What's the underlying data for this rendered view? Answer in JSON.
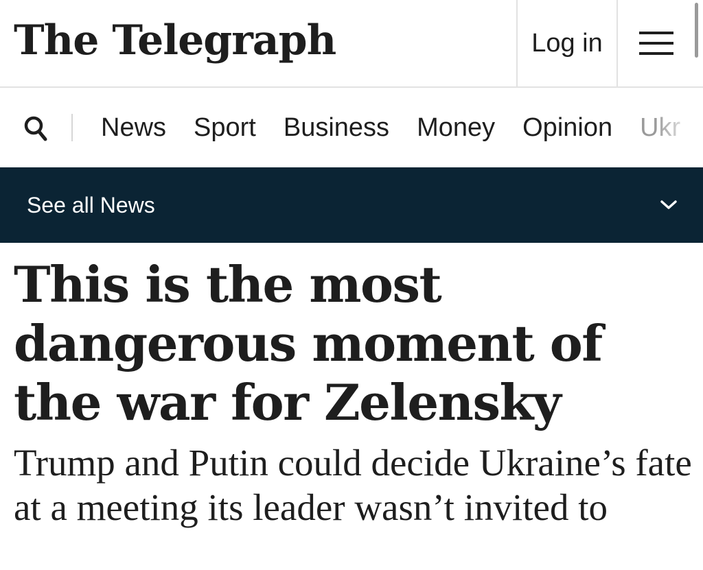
{
  "header": {
    "logo_text": "The Telegraph",
    "login_label": "Log in",
    "menu_icon": "hamburger-menu-icon"
  },
  "nav": {
    "search_icon": "search-icon",
    "links": [
      {
        "label": "News"
      },
      {
        "label": "Sport"
      },
      {
        "label": "Business"
      },
      {
        "label": "Money"
      },
      {
        "label": "Opinion"
      },
      {
        "label": "Ukr"
      }
    ]
  },
  "section_bar": {
    "label": "See all News",
    "icon": "chevron-down-icon",
    "background": "#0b2434"
  },
  "article": {
    "headline": "This is the most dangerous moment of the war for Zelensky",
    "standfirst": "Trump and Putin could decide Ukraine’s fate at a meeting its leader wasn’t invited to"
  }
}
